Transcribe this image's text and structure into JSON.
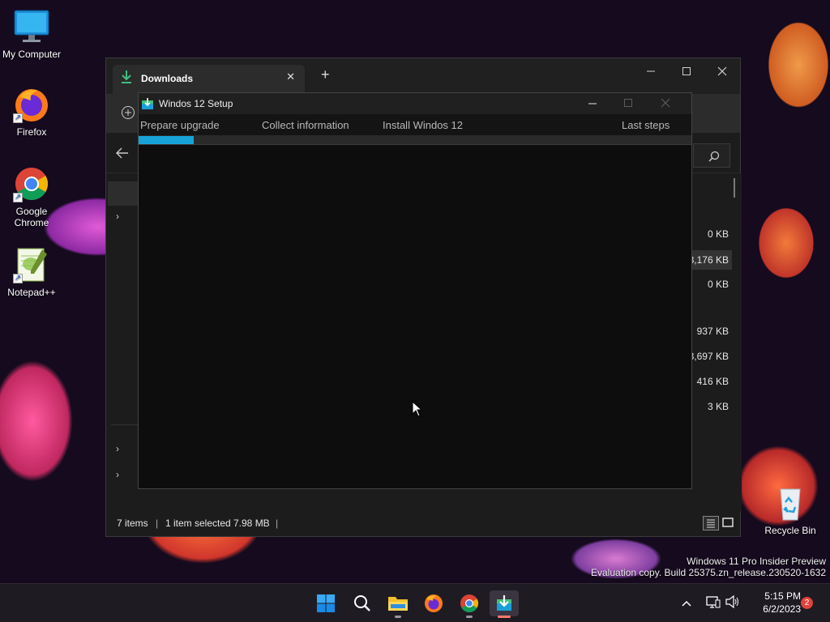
{
  "desktop": {
    "icons": [
      {
        "label": "My Computer",
        "icon": "monitor-icon"
      },
      {
        "label": "Firefox",
        "icon": "firefox-icon"
      },
      {
        "label": "Google Chrome",
        "icon": "chrome-icon"
      },
      {
        "label": "Notepad++",
        "icon": "notepadpp-icon"
      }
    ],
    "recycle_bin": {
      "label": "Recycle Bin",
      "icon": "recycle-bin-icon"
    },
    "watermark": {
      "line1": "Windows 11 Pro Insider Preview",
      "line2": "Evaluation copy. Build 25375.zn_release.230520-1632"
    }
  },
  "explorer": {
    "tab_label": "Downloads",
    "tab_close": "✕",
    "new_tab": "+",
    "file_sizes": [
      "0 KB",
      "8,176 KB",
      "0 KB",
      "937 KB",
      "3,697 KB",
      "416 KB",
      "3 KB"
    ],
    "selected_row_index": 1,
    "status": {
      "items": "7 items",
      "selected": "1 item selected",
      "size": "7.98 MB",
      "separator": "|"
    }
  },
  "setup": {
    "title": "Windos 12 Setup",
    "steps": [
      "Prepare upgrade",
      "Collect information",
      "Install Windos 12",
      "Last steps"
    ],
    "progress_fraction": 0.1,
    "accent": "#16a4d8"
  },
  "taskbar": {
    "apps": [
      "start-icon",
      "search-icon",
      "file-explorer-icon",
      "firefox-icon",
      "chrome-icon",
      "setup-app-icon"
    ],
    "time": "5:15 PM",
    "date": "6/2/2023",
    "notification_count": "2"
  },
  "colors": {
    "window_bg": "#1c1c1c",
    "dialog_bg": "#0d0d0d",
    "progress": "#16a4d8",
    "badge": "#e0433a"
  }
}
